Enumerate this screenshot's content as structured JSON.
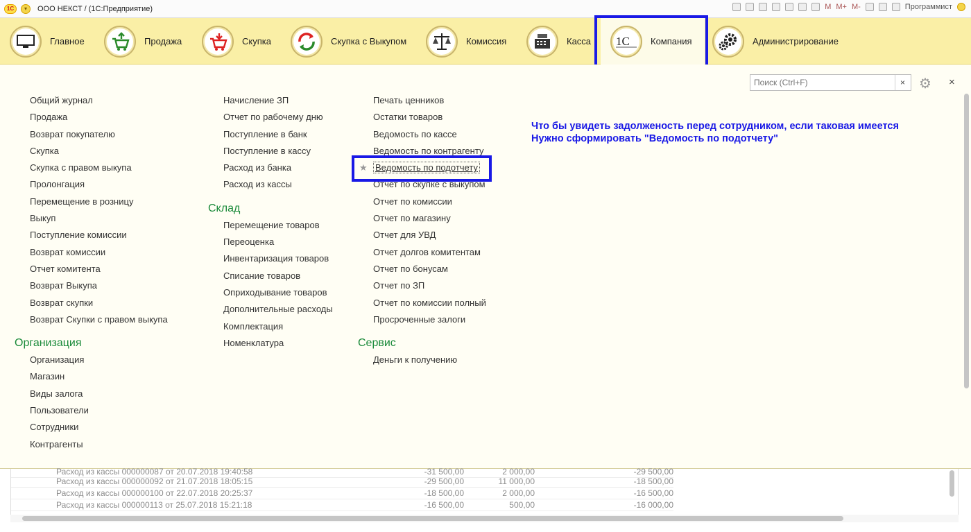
{
  "titlebar": {
    "logo": "1С",
    "title": "ООО НЕКСТ /   (1С:Предприятие)",
    "m": "M",
    "mplus": "M+",
    "mminus": "M-",
    "user": "Программист"
  },
  "sections": [
    {
      "label": "Главное",
      "icon": "computer-icon"
    },
    {
      "label": "Продажа",
      "icon": "cart-up-icon"
    },
    {
      "label": "Скупка",
      "icon": "cart-down-icon"
    },
    {
      "label": "Скупка с Выкупом",
      "icon": "cycle-arrows-icon"
    },
    {
      "label": "Комиссия",
      "icon": "scales-icon"
    },
    {
      "label": "Касса",
      "icon": "cash-register-icon"
    },
    {
      "label": "Компания",
      "icon": "company-logo-icon"
    },
    {
      "label": "Администрирование",
      "icon": "gears-icon"
    }
  ],
  "search": {
    "placeholder": "Поиск (Ctrl+F)",
    "clear": "×"
  },
  "close": "×",
  "col1": {
    "items": [
      "Общий журнал",
      "Продажа",
      "Возврат покупателю",
      "Скупка",
      "Скупка с правом выкупа",
      "Пролонгация",
      "Перемещение в розницу",
      "Выкуп",
      "Поступление комиссии",
      "Возврат комиссии",
      "Отчет комитента",
      "Возврат Выкупа",
      "Возврат скупки",
      "Возврат Скупки с правом выкупа"
    ],
    "group_title": "Организация",
    "group_items": [
      "Организация",
      "Магазин",
      "Виды залога",
      "Пользователи",
      "Сотрудники",
      "Контрагенты"
    ]
  },
  "col2": {
    "items": [
      "Начисление ЗП",
      "Отчет по рабочему дню",
      "Поступление в банк",
      "Поступление в кассу",
      "Расход из банка",
      "Расход из кассы"
    ],
    "group_title": "Склад",
    "group_items": [
      "Перемещение товаров",
      "Переоценка",
      "Инвентаризация товаров",
      "Списание товаров",
      "Оприходывание товаров",
      "Дополнительные расходы",
      "Комплектация",
      "Номенклатура"
    ]
  },
  "col3": {
    "items": [
      "Печать ценников",
      "Остатки товаров",
      "Ведомость по кассе",
      "Ведомость по контрагенту",
      "Ведомость по подотчету",
      "Отчет по скупке с выкупом",
      "Отчет по комиссии",
      "Отчет по магазину",
      "Отчет для УВД",
      "Отчет долгов комитентам",
      "Отчет по бонусам",
      "Отчет по ЗП",
      "Отчет по комиссии полный",
      "Просроченные залоги"
    ],
    "group_title": "Сервис",
    "group_items": [
      "Деньги к получению"
    ]
  },
  "note": {
    "line1": "Что бы увидеть задолженость перед сотрудником, если таковая имеется",
    "line2": "Нужно сформировать \"Ведомость по подотчету\""
  },
  "background_table": {
    "rows": [
      {
        "doc": "Расход из кассы 000000087 от 20.07.2018 19:40:58",
        "a": "-31 500,00",
        "b": "2 000,00",
        "c": "-29 500,00"
      },
      {
        "doc": "Расход из кассы 000000092 от 21.07.2018 18:05:15",
        "a": "-29 500,00",
        "b": "11 000,00",
        "c": "-18 500,00"
      },
      {
        "doc": "Расход из кассы 000000100 от 22.07.2018 20:25:37",
        "a": "-18 500,00",
        "b": "2 000,00",
        "c": "-16 500,00"
      },
      {
        "doc": "Расход из кассы 000000113 от 25.07.2018 15:21:18",
        "a": "-16 500,00",
        "b": "500,00",
        "c": "-16 000,00"
      }
    ]
  }
}
